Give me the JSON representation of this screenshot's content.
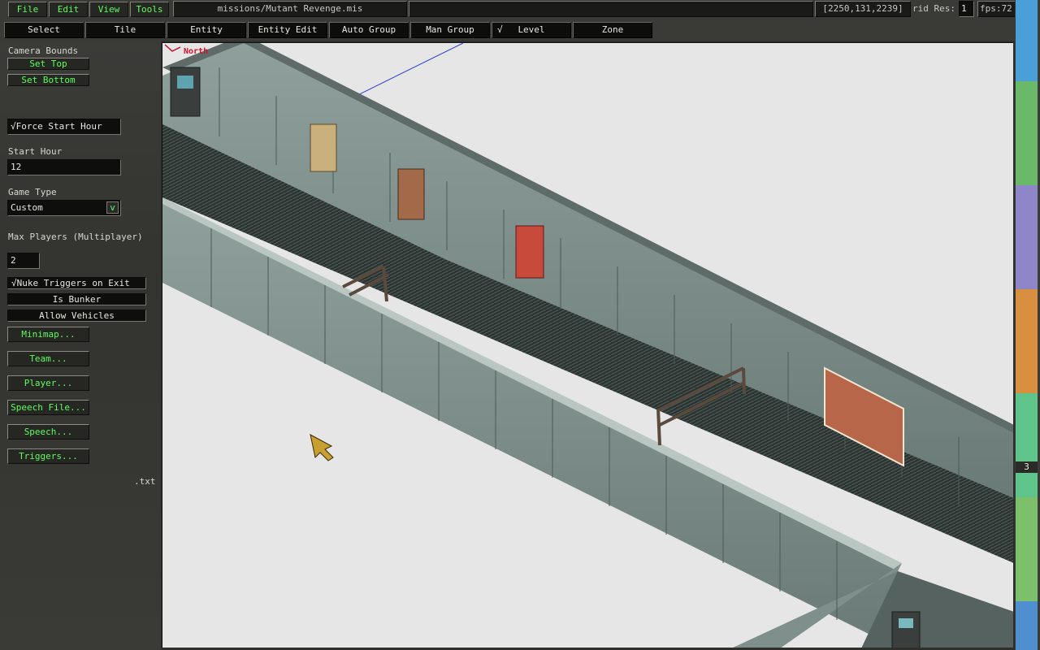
{
  "menu": {
    "file": "File",
    "edit": "Edit",
    "view": "View",
    "tools": "Tools"
  },
  "title": {
    "path": "missions/Mutant Revenge.mis",
    "coords": "[2250,131,2239]",
    "grid_label": "rid Res:",
    "grid_value": "1",
    "fps": "fps:72"
  },
  "modes": [
    {
      "label": "Select"
    },
    {
      "label": "Tile"
    },
    {
      "label": "Entity"
    },
    {
      "label": "Entity Edit"
    },
    {
      "label": "Auto Group"
    },
    {
      "label": "Man Group"
    },
    {
      "label": "Level",
      "checked": "√"
    },
    {
      "label": "Zone"
    }
  ],
  "sidebar": {
    "camera_bounds": "Camera Bounds",
    "set_top": "Set Top",
    "set_bottom": "Set Bottom",
    "force_start_hour": "Force Start Hour",
    "force_start_check": "√",
    "start_hour_label": "Start Hour",
    "start_hour_value": "12",
    "game_type_label": "Game Type",
    "game_type_value": "Custom",
    "dropdown_glyph": "v",
    "max_players_label": "Max Players (Multiplayer)",
    "max_players_value": "2",
    "nuke_triggers": "Nuke Triggers on Exit",
    "nuke_check": "√",
    "is_bunker": "Is Bunker",
    "allow_vehicles": "Allow Vehicles",
    "minimap": "Minimap...",
    "team": "Team...",
    "player": "Player...",
    "speech_file": "Speech File...",
    "speech": "Speech...",
    "triggers": "Triggers...",
    "txt_ext": ".txt"
  },
  "viewport": {
    "north_label": "North"
  },
  "level_bar": {
    "current_level": "3",
    "colors": [
      "#4a9fd8",
      "#6ab86a",
      "#8e86c8",
      "#d89040",
      "#5ec48a",
      "#7cc06c",
      "#4f8fd0"
    ]
  }
}
